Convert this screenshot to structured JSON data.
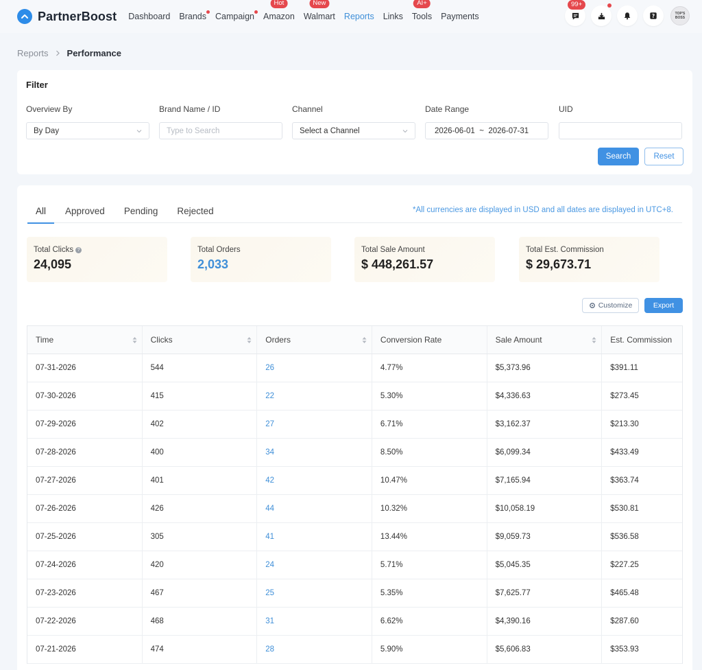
{
  "app": {
    "name": "PartnerBoost"
  },
  "nav": {
    "items": [
      {
        "label": "Dashboard"
      },
      {
        "label": "Brands",
        "dot": true
      },
      {
        "label": "Campaign",
        "dot": true
      },
      {
        "label": "Amazon",
        "badge": "Hot"
      },
      {
        "label": "Walmart",
        "badge": "New"
      },
      {
        "label": "Reports",
        "active": true
      },
      {
        "label": "Links"
      },
      {
        "label": "Tools",
        "badge": "AI+"
      },
      {
        "label": "Payments"
      }
    ],
    "icons": [
      {
        "name": "message-icon",
        "badge": "99+"
      },
      {
        "name": "download-icon",
        "dot": true
      },
      {
        "name": "bell-icon"
      },
      {
        "name": "help-icon"
      }
    ],
    "avatar_text": "TOP'S BOSS"
  },
  "breadcrumb": {
    "parent": "Reports",
    "current": "Performance"
  },
  "filter": {
    "title": "Filter",
    "overview_label": "Overview By",
    "overview_value": "By Day",
    "brand_label": "Brand Name / ID",
    "brand_placeholder": "Type to Search",
    "channel_label": "Channel",
    "channel_value": "Select a Channel",
    "date_label": "Date Range",
    "date_value": "2026-06-01  ~  2026-07-31",
    "uid_label": "UID",
    "uid_value": "",
    "search_label": "Search",
    "reset_label": "Reset"
  },
  "tabs": [
    {
      "label": "All",
      "active": true
    },
    {
      "label": "Approved"
    },
    {
      "label": "Pending"
    },
    {
      "label": "Rejected"
    }
  ],
  "currency_note": "*All currencies are displayed in USD and all dates are displayed in UTC+8.",
  "stats": [
    {
      "label": "Total Clicks",
      "value": "24,095",
      "help": true
    },
    {
      "label": "Total Orders",
      "value": "2,033",
      "link": true
    },
    {
      "label": "Total Sale Amount",
      "value": "$ 448,261.57"
    },
    {
      "label": "Total Est. Commission",
      "value": "$ 29,673.71"
    }
  ],
  "actions": {
    "customize_label": "Customize",
    "export_label": "Export"
  },
  "table": {
    "columns": [
      {
        "label": "Time",
        "sortable": true
      },
      {
        "label": "Clicks",
        "sortable": true
      },
      {
        "label": "Orders",
        "sortable": true
      },
      {
        "label": "Conversion Rate",
        "sortable": false
      },
      {
        "label": "Sale Amount",
        "sortable": true
      },
      {
        "label": "Est. Commission",
        "sortable": false
      }
    ],
    "rows": [
      [
        "07-31-2026",
        "544",
        "26",
        "4.77%",
        "$5,373.96",
        "$391.11"
      ],
      [
        "07-30-2026",
        "415",
        "22",
        "5.30%",
        "$4,336.63",
        "$273.45"
      ],
      [
        "07-29-2026",
        "402",
        "27",
        "6.71%",
        "$3,162.37",
        "$213.30"
      ],
      [
        "07-28-2026",
        "400",
        "34",
        "8.50%",
        "$6,099.34",
        "$433.49"
      ],
      [
        "07-27-2026",
        "401",
        "42",
        "10.47%",
        "$7,165.94",
        "$363.74"
      ],
      [
        "07-26-2026",
        "426",
        "44",
        "10.32%",
        "$10,058.19",
        "$530.81"
      ],
      [
        "07-25-2026",
        "305",
        "41",
        "13.44%",
        "$9,059.73",
        "$536.58"
      ],
      [
        "07-24-2026",
        "420",
        "24",
        "5.71%",
        "$5,045.35",
        "$227.25"
      ],
      [
        "07-23-2026",
        "467",
        "25",
        "5.35%",
        "$7,625.77",
        "$465.48"
      ],
      [
        "07-22-2026",
        "468",
        "31",
        "6.62%",
        "$4,390.16",
        "$287.60"
      ],
      [
        "07-21-2026",
        "474",
        "28",
        "5.90%",
        "$5,606.83",
        "$353.93"
      ]
    ]
  },
  "colors": {
    "accent": "#4091e3",
    "badge": "#e5484d",
    "link": "#3f8fd8"
  }
}
